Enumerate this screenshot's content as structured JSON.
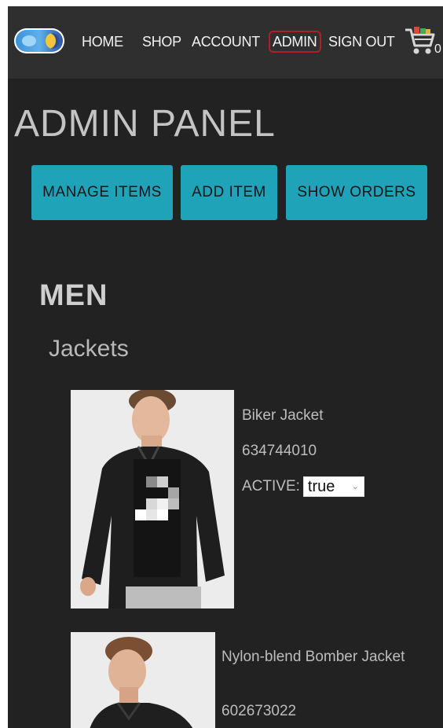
{
  "nav": {
    "logo_icon": "moon-planet-logo",
    "links": [
      "HOME",
      "SHOP",
      "ACCOUNT",
      "ADMIN",
      "SIGN OUT"
    ],
    "active_link": "ADMIN",
    "cart_icon": "shopping-cart-icon",
    "cart_count": "0"
  },
  "page": {
    "title": "ADMIN PANEL"
  },
  "admin_buttons": {
    "manage_items": "MANAGE ITEMS",
    "add_item": "ADD ITEM",
    "show_orders": "SHOW ORDERS"
  },
  "catalog": {
    "category": "MEN",
    "subcategory": "Jackets",
    "items": [
      {
        "name": "Biker Jacket",
        "code": "634744010",
        "active_label": "ACTIVE:",
        "active_value": "true"
      },
      {
        "name": "Nylon-blend Bomber Jacket",
        "code": "602673022"
      }
    ]
  },
  "colors": {
    "background": "#222222",
    "navbar": "#2f2f2f",
    "accent": "#1ea3b9",
    "active_border": "#b01f24",
    "text_light": "#bdbdbd"
  }
}
